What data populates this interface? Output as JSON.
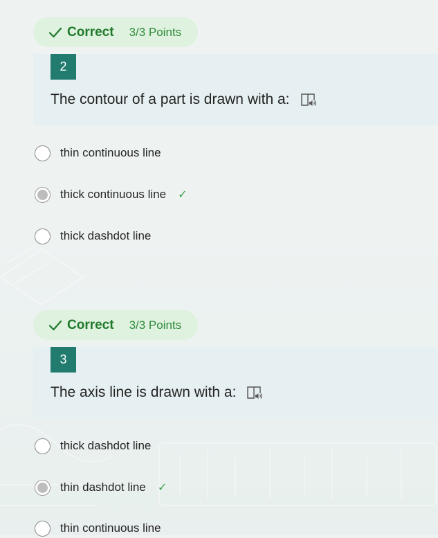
{
  "colors": {
    "page_background": "#eef3f2",
    "pill_background": "#dff1df",
    "correct_green": "#1f7a2a",
    "number_badge": "#217b6f",
    "question_card": "#e6eff1"
  },
  "questions": [
    {
      "result": {
        "icon": "check-icon",
        "label": "Correct",
        "points": "3/3 Points"
      },
      "number": "2",
      "text": "The contour of a part is drawn with a:",
      "reader_icon": "immersive-reader-icon",
      "options": [
        {
          "label": "thin continuous line",
          "selected": false,
          "correct_mark": ""
        },
        {
          "label": "thick continuous line",
          "selected": true,
          "correct_mark": "✓"
        },
        {
          "label": "thick dashdot line",
          "selected": false,
          "correct_mark": ""
        }
      ]
    },
    {
      "result": {
        "icon": "check-icon",
        "label": "Correct",
        "points": "3/3 Points"
      },
      "number": "3",
      "text": "The axis line is drawn with a:",
      "reader_icon": "immersive-reader-icon",
      "options": [
        {
          "label": "thick dashdot line",
          "selected": false,
          "correct_mark": ""
        },
        {
          "label": "thin dashdot line",
          "selected": true,
          "correct_mark": "✓"
        },
        {
          "label": "thin continuous line",
          "selected": false,
          "correct_mark": ""
        }
      ]
    }
  ]
}
